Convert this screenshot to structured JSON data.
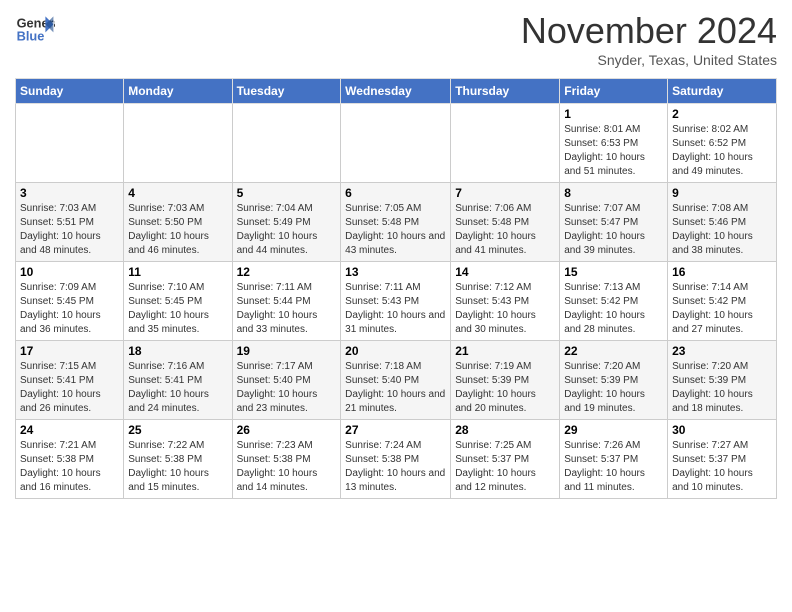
{
  "header": {
    "logo_line1": "General",
    "logo_line2": "Blue",
    "month": "November 2024",
    "location": "Snyder, Texas, United States"
  },
  "days_of_week": [
    "Sunday",
    "Monday",
    "Tuesday",
    "Wednesday",
    "Thursday",
    "Friday",
    "Saturday"
  ],
  "weeks": [
    [
      {
        "day": "",
        "info": ""
      },
      {
        "day": "",
        "info": ""
      },
      {
        "day": "",
        "info": ""
      },
      {
        "day": "",
        "info": ""
      },
      {
        "day": "",
        "info": ""
      },
      {
        "day": "1",
        "info": "Sunrise: 8:01 AM\nSunset: 6:53 PM\nDaylight: 10 hours and 51 minutes."
      },
      {
        "day": "2",
        "info": "Sunrise: 8:02 AM\nSunset: 6:52 PM\nDaylight: 10 hours and 49 minutes."
      }
    ],
    [
      {
        "day": "3",
        "info": "Sunrise: 7:03 AM\nSunset: 5:51 PM\nDaylight: 10 hours and 48 minutes."
      },
      {
        "day": "4",
        "info": "Sunrise: 7:03 AM\nSunset: 5:50 PM\nDaylight: 10 hours and 46 minutes."
      },
      {
        "day": "5",
        "info": "Sunrise: 7:04 AM\nSunset: 5:49 PM\nDaylight: 10 hours and 44 minutes."
      },
      {
        "day": "6",
        "info": "Sunrise: 7:05 AM\nSunset: 5:48 PM\nDaylight: 10 hours and 43 minutes."
      },
      {
        "day": "7",
        "info": "Sunrise: 7:06 AM\nSunset: 5:48 PM\nDaylight: 10 hours and 41 minutes."
      },
      {
        "day": "8",
        "info": "Sunrise: 7:07 AM\nSunset: 5:47 PM\nDaylight: 10 hours and 39 minutes."
      },
      {
        "day": "9",
        "info": "Sunrise: 7:08 AM\nSunset: 5:46 PM\nDaylight: 10 hours and 38 minutes."
      }
    ],
    [
      {
        "day": "10",
        "info": "Sunrise: 7:09 AM\nSunset: 5:45 PM\nDaylight: 10 hours and 36 minutes."
      },
      {
        "day": "11",
        "info": "Sunrise: 7:10 AM\nSunset: 5:45 PM\nDaylight: 10 hours and 35 minutes."
      },
      {
        "day": "12",
        "info": "Sunrise: 7:11 AM\nSunset: 5:44 PM\nDaylight: 10 hours and 33 minutes."
      },
      {
        "day": "13",
        "info": "Sunrise: 7:11 AM\nSunset: 5:43 PM\nDaylight: 10 hours and 31 minutes."
      },
      {
        "day": "14",
        "info": "Sunrise: 7:12 AM\nSunset: 5:43 PM\nDaylight: 10 hours and 30 minutes."
      },
      {
        "day": "15",
        "info": "Sunrise: 7:13 AM\nSunset: 5:42 PM\nDaylight: 10 hours and 28 minutes."
      },
      {
        "day": "16",
        "info": "Sunrise: 7:14 AM\nSunset: 5:42 PM\nDaylight: 10 hours and 27 minutes."
      }
    ],
    [
      {
        "day": "17",
        "info": "Sunrise: 7:15 AM\nSunset: 5:41 PM\nDaylight: 10 hours and 26 minutes."
      },
      {
        "day": "18",
        "info": "Sunrise: 7:16 AM\nSunset: 5:41 PM\nDaylight: 10 hours and 24 minutes."
      },
      {
        "day": "19",
        "info": "Sunrise: 7:17 AM\nSunset: 5:40 PM\nDaylight: 10 hours and 23 minutes."
      },
      {
        "day": "20",
        "info": "Sunrise: 7:18 AM\nSunset: 5:40 PM\nDaylight: 10 hours and 21 minutes."
      },
      {
        "day": "21",
        "info": "Sunrise: 7:19 AM\nSunset: 5:39 PM\nDaylight: 10 hours and 20 minutes."
      },
      {
        "day": "22",
        "info": "Sunrise: 7:20 AM\nSunset: 5:39 PM\nDaylight: 10 hours and 19 minutes."
      },
      {
        "day": "23",
        "info": "Sunrise: 7:20 AM\nSunset: 5:39 PM\nDaylight: 10 hours and 18 minutes."
      }
    ],
    [
      {
        "day": "24",
        "info": "Sunrise: 7:21 AM\nSunset: 5:38 PM\nDaylight: 10 hours and 16 minutes."
      },
      {
        "day": "25",
        "info": "Sunrise: 7:22 AM\nSunset: 5:38 PM\nDaylight: 10 hours and 15 minutes."
      },
      {
        "day": "26",
        "info": "Sunrise: 7:23 AM\nSunset: 5:38 PM\nDaylight: 10 hours and 14 minutes."
      },
      {
        "day": "27",
        "info": "Sunrise: 7:24 AM\nSunset: 5:38 PM\nDaylight: 10 hours and 13 minutes."
      },
      {
        "day": "28",
        "info": "Sunrise: 7:25 AM\nSunset: 5:37 PM\nDaylight: 10 hours and 12 minutes."
      },
      {
        "day": "29",
        "info": "Sunrise: 7:26 AM\nSunset: 5:37 PM\nDaylight: 10 hours and 11 minutes."
      },
      {
        "day": "30",
        "info": "Sunrise: 7:27 AM\nSunset: 5:37 PM\nDaylight: 10 hours and 10 minutes."
      }
    ]
  ]
}
